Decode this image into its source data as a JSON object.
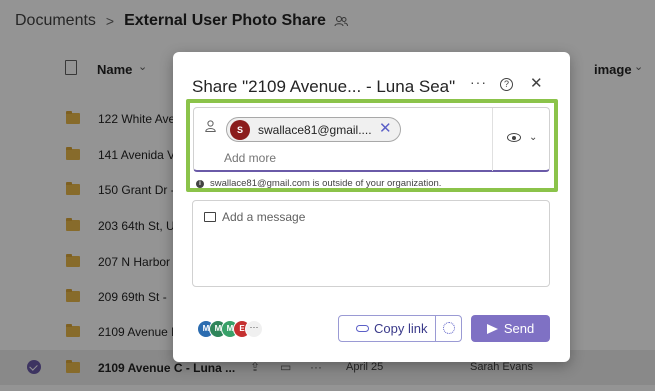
{
  "breadcrumb": {
    "root": "Documents",
    "separator": ">",
    "current": "External User Photo Share"
  },
  "columns": {
    "name": "Name",
    "image": "image"
  },
  "rows": [
    {
      "name": "122 White Ave"
    },
    {
      "name": "141 Avenida Ve"
    },
    {
      "name": "150 Grant Dr -"
    },
    {
      "name": "203 64th St, U"
    },
    {
      "name": "207 N Harbor"
    },
    {
      "name": "209 69th St -"
    },
    {
      "name": "2109 Avenue E"
    },
    {
      "name": "2109 Avenue C - Luna ...",
      "date": "April 25",
      "owner": "Sarah Evans",
      "selected": true
    }
  ],
  "dialog": {
    "title": "Share \"2109 Avenue... - Luna Sea\"",
    "more_label": "···",
    "help_label": "?",
    "close_label": "✕",
    "recipient": {
      "initial": "S",
      "email": "swallace81@gmail....",
      "avatar_color": "#8b1d1d"
    },
    "add_more_placeholder": "Add more",
    "warning": "swallace81@gmail.com is outside of your organization.",
    "message_placeholder": "Add a message",
    "shared_avatars": [
      {
        "initial": "M",
        "color": "#2b6cb0"
      },
      {
        "initial": "M",
        "color": "#2f855a"
      },
      {
        "initial": "M",
        "color": "#38a169"
      },
      {
        "initial": "E",
        "color": "#c53030"
      }
    ],
    "more_avatars_label": "···",
    "copy_link_label": "Copy link",
    "send_label": "Send"
  },
  "colors": {
    "accent": "#7f71c4",
    "highlight": "#8bc34a",
    "folder": "#e8b84a"
  }
}
